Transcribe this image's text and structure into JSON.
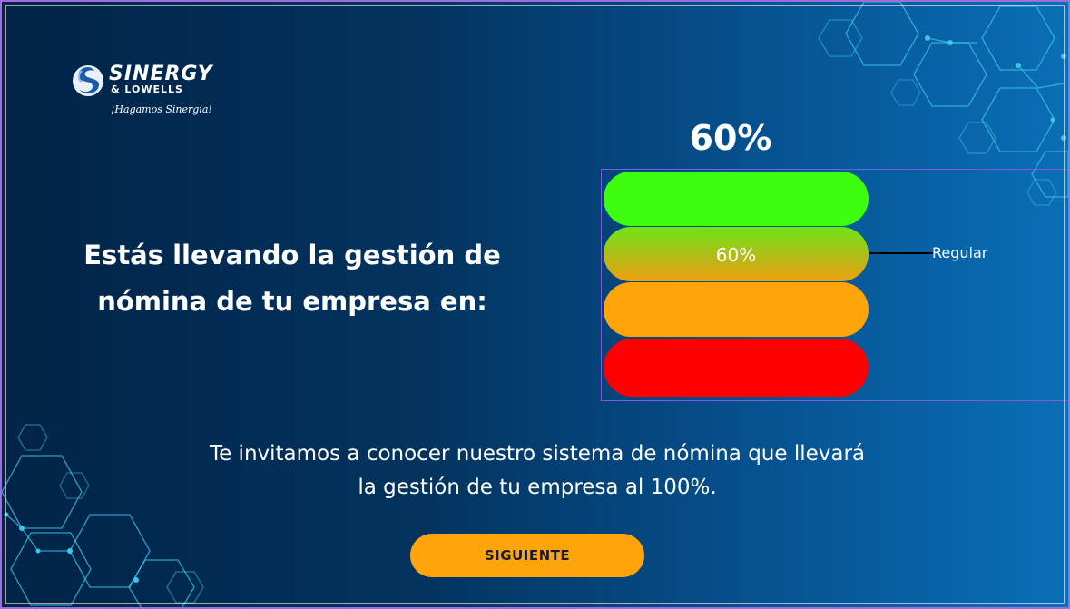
{
  "brand": {
    "name": "SINERGY",
    "sub": "& LOWELLS",
    "tagline": "¡Hagamos Sinergia!"
  },
  "headline": {
    "line1": "Estás llevando la gestión de",
    "line2": "nómina de tu empresa en:"
  },
  "result": {
    "percent_label": "60%",
    "bar_label": "60%",
    "level_label": "Regular",
    "level_index": 1,
    "percent_value": 60
  },
  "gauge_levels": [
    {
      "color": "#3cfe0e"
    },
    {
      "color": "#b9b717"
    },
    {
      "color": "#ffa40b"
    },
    {
      "color": "#ff0000"
    }
  ],
  "invite": {
    "line1": "Te invitamos a conocer nuestro sistema de nómina que llevará",
    "line2": "la gestión de tu empresa al 100%."
  },
  "next_button": {
    "label": "SIGUIENTE"
  },
  "colors": {
    "accent": "#ffa40b",
    "frame_border": "#9b6fe0",
    "hex_lines": "#3bc6e8"
  }
}
